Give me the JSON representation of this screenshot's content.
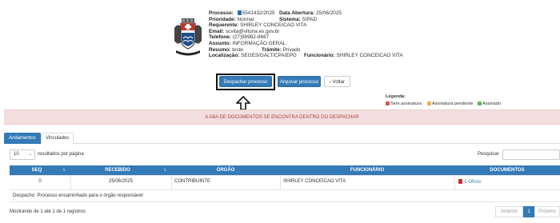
{
  "process": {
    "processo_label": "Processo:",
    "processo_value": "5541432/2025",
    "data_abertura_label": "Data Abertura:",
    "data_abertura_value": "25/06/2025",
    "prioridade_label": "Prioridade:",
    "prioridade_value": "Normal",
    "sistema_label": "Sistema:",
    "sistema_value": "SIPAD",
    "requerente_label": "Requerente:",
    "requerente_value": "SHIRLEY CONCEICAO VITA",
    "email_label": "Email:",
    "email_value": "scvita@vitoria.es.gov.br",
    "telefone_label": "Telefone:",
    "telefone_value": "(27)99982-8687",
    "assunto_label": "Assunto:",
    "assunto_value": "INFORMAÇÃO GERAL",
    "resumo_label": "Resumo:",
    "resumo_value": "teste",
    "tramite_label": "Trâmite:",
    "tramite_value": "Privado",
    "localizacao_label": "Localização:",
    "localizacao_value": "SEGES/GALT/CPA/EPG",
    "funcionario_label": "Funcionário:",
    "funcionario_value": "SHIRLEY CONCEICAO VITA"
  },
  "actions": {
    "despachar": "Despachar processo",
    "arquivar": "Arquivar processo",
    "voltar": "Voltar"
  },
  "legend": {
    "title": "Legenda:",
    "items": [
      {
        "label": "Sem assinatura",
        "color": "#d9534f"
      },
      {
        "label": "Assinatura pendente",
        "color": "#f0ad4e"
      },
      {
        "label": "Assinado",
        "color": "#5cb85c"
      }
    ]
  },
  "alert": {
    "text": "A ABA DE DOCUMENTOS SE ENCONTRA DENTRO DO DESPACHAR"
  },
  "tabs": [
    {
      "label": "Andamentos",
      "active": true
    },
    {
      "label": "Vinculados",
      "active": false
    }
  ],
  "table_controls": {
    "page_size": "10",
    "page_size_suffix": "resultados por página",
    "search_label": "Pesquisar"
  },
  "table": {
    "headers": [
      "SEQ",
      "RECEBIDO",
      "ÓRGÃO",
      "FUNCIONÁRIO",
      "DOCUMENTOS"
    ],
    "rows": [
      {
        "seq": "0",
        "recebido": "25/06/2025",
        "orgao": "CONTRIBUINTE",
        "funcionario": "SHIRLEY CONCEICAO VITA",
        "documento": "1-Ofício",
        "despacho": "Despacho: Processo encaminhado para o órgão responsável"
      }
    ]
  },
  "footer": {
    "info": "Mostrando de 1 até 1 de 1 registros",
    "pagination": {
      "prev": "Anterior",
      "current": "1",
      "next": "Próximo"
    }
  },
  "colors": {
    "primary": "#337ab7",
    "alert_bg": "#f2dede",
    "alert_text": "#a94442"
  }
}
